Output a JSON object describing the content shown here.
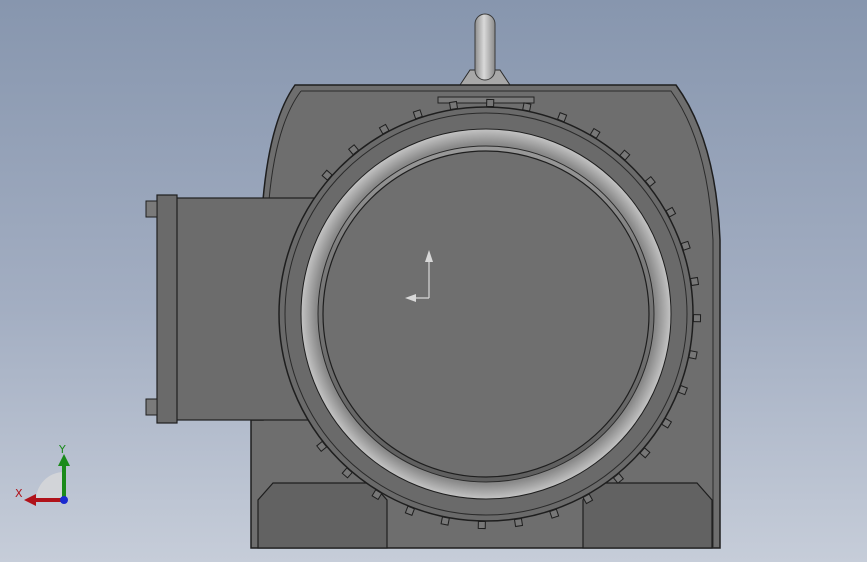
{
  "viewport": {
    "model": "gearbox-front-view"
  },
  "triad": {
    "x_label": "X",
    "y_label": "Y"
  },
  "colors": {
    "bg_top": "#8796ae",
    "bg_bottom": "#c6cdd9",
    "body": "#6d6d6d",
    "edge": "#1e1e1e",
    "axis_x": "#b0121a",
    "axis_y": "#1a8a1a",
    "axis_z": "#1a2ad0"
  }
}
